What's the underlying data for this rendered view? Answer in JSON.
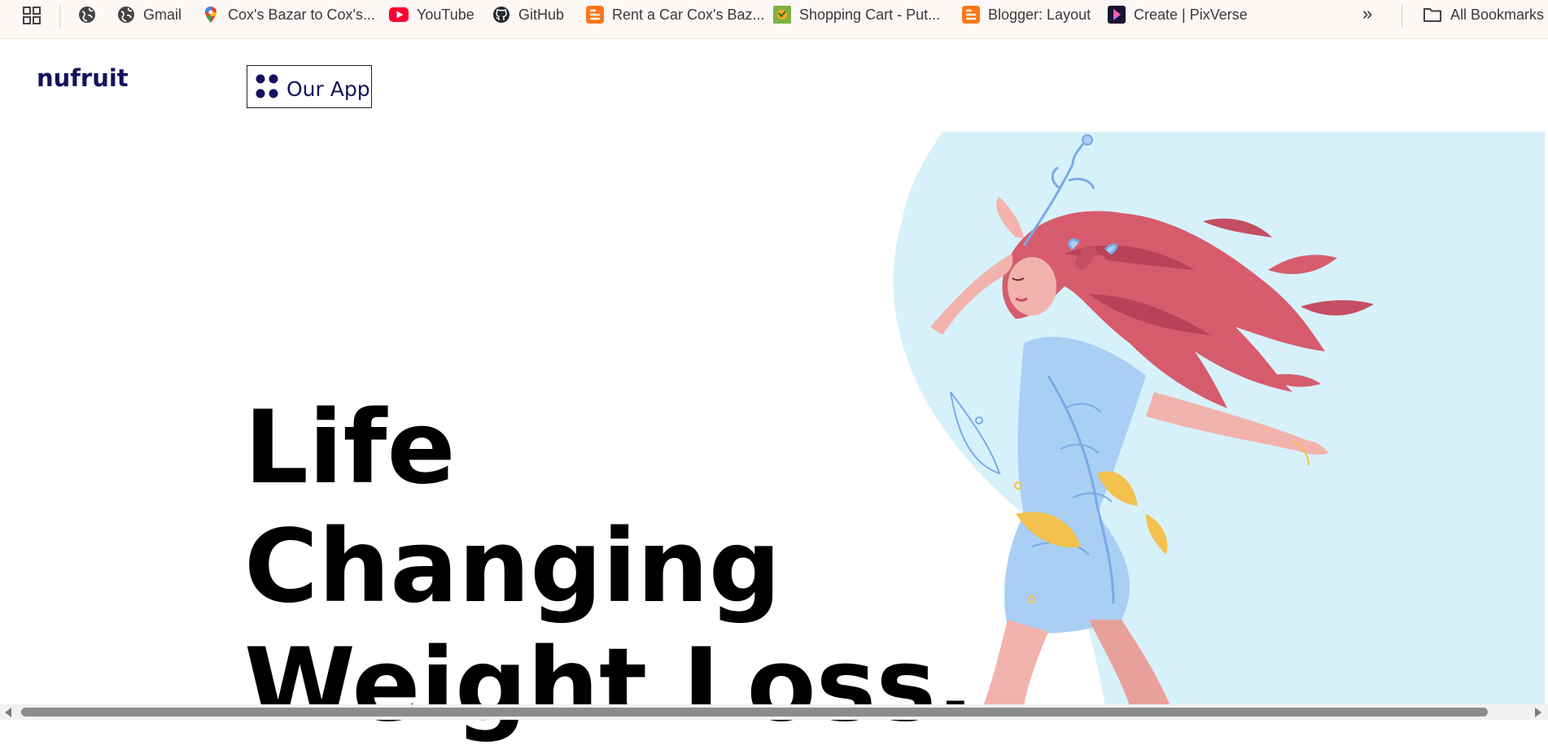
{
  "bookmarks_bar": {
    "items": [
      {
        "label": "",
        "icon": "globe-icon"
      },
      {
        "label": "Gmail",
        "icon": "globe-icon"
      },
      {
        "label": "Cox's Bazar to Cox's...",
        "icon": "map-pin-icon"
      },
      {
        "label": "YouTube",
        "icon": "youtube-icon"
      },
      {
        "label": "GitHub",
        "icon": "github-icon"
      },
      {
        "label": "Rent a Car Cox's Baz...",
        "icon": "blogger-icon"
      },
      {
        "label": "Shopping Cart - Put...",
        "icon": "shopping-cart-icon"
      },
      {
        "label": "Blogger: Layout",
        "icon": "blogger-icon"
      },
      {
        "label": "Create | PixVerse",
        "icon": "pixverse-icon"
      }
    ],
    "more_label": "»",
    "all_bookmarks_label": "All Bookmarks"
  },
  "header": {
    "logo": "nufruit",
    "app_button_label": "Our App"
  },
  "hero": {
    "title_lines": [
      "Life",
      "Changing",
      "Weight Loss."
    ]
  },
  "colors": {
    "logo": "#13105f",
    "hero_bg": "#d7f1fb",
    "hair": "#d65c6d",
    "dress": "#a9cff4"
  }
}
